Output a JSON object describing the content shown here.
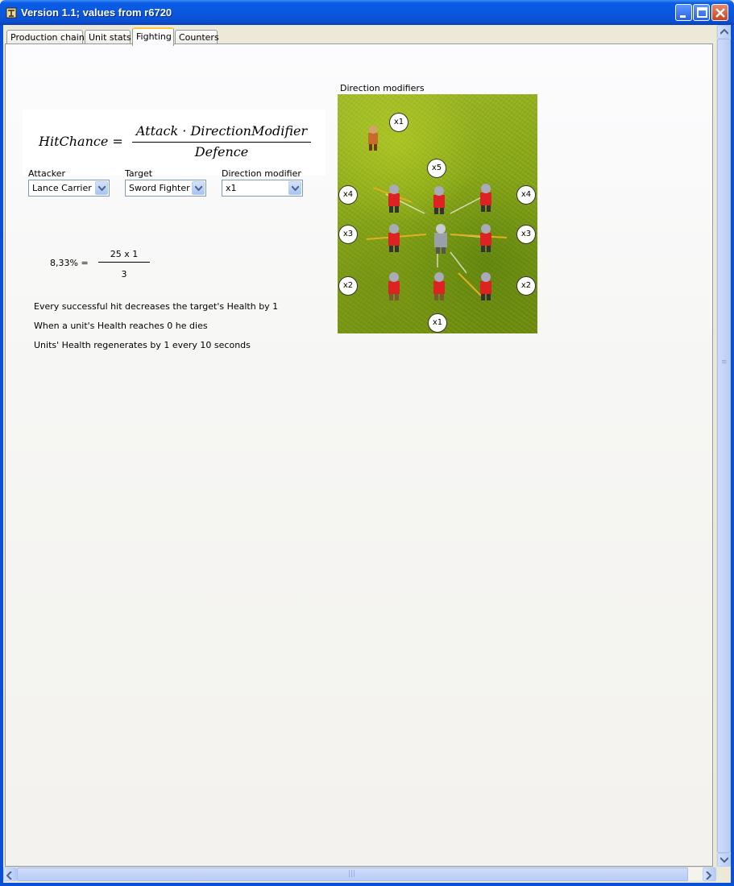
{
  "window": {
    "title": "Version 1.1; values from r6720"
  },
  "tabs": [
    {
      "label": "Production chains"
    },
    {
      "label": "Unit stats"
    },
    {
      "label": "Fighting",
      "active": true
    },
    {
      "label": "Counters"
    }
  ],
  "formula": {
    "lhs": "HitChance =",
    "numerator": "Attack · DirectionModifier",
    "denominator": "Defence"
  },
  "selectors": {
    "attacker": {
      "label": "Attacker",
      "value": "Lance Carrier"
    },
    "target": {
      "label": "Target",
      "value": "Sword Fighter"
    },
    "direction": {
      "label": "Direction modifier",
      "value": "x1"
    }
  },
  "calc": {
    "result": "8,33%  =",
    "numerator": "25 x 1",
    "denominator": "3"
  },
  "info": [
    "Every successful hit decreases the target's Health by 1",
    "When a unit's Health reaches 0 he dies",
    "Units' Health regenerates by 1 every 10 seconds"
  ],
  "direction_image": {
    "title": "Direction modifiers",
    "badges": [
      "x1",
      "x5",
      "x4",
      "x4",
      "x3",
      "x3",
      "x2",
      "x2",
      "x1"
    ]
  },
  "colors": {
    "titlebar": "#0a58de",
    "grass": "#88a818",
    "tab_highlight": "#ffc83c"
  }
}
